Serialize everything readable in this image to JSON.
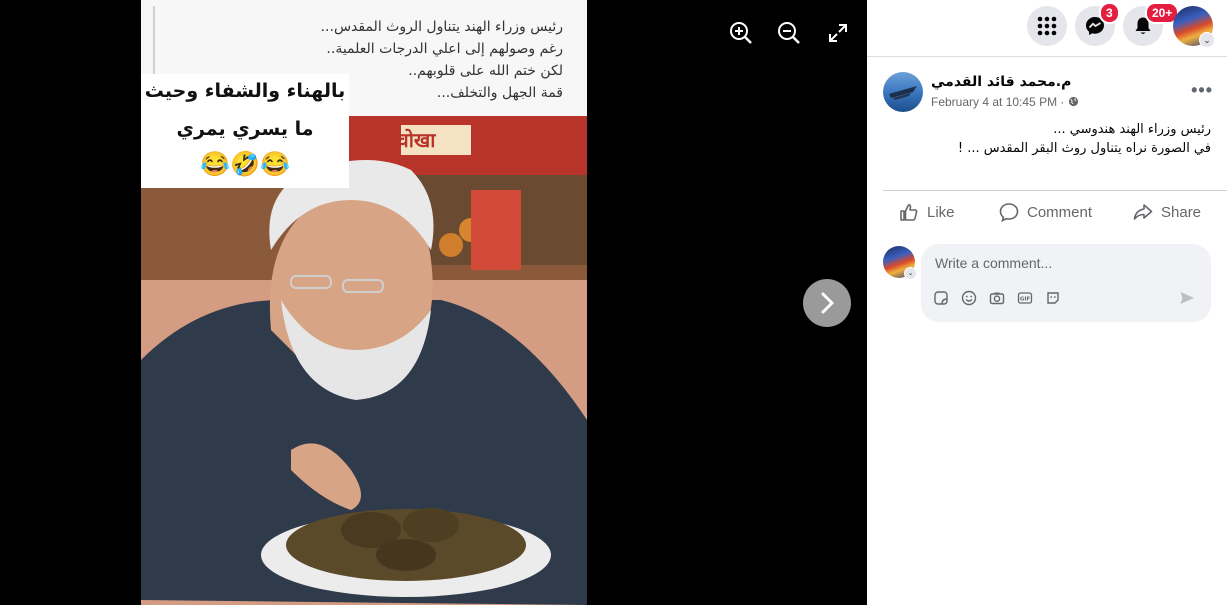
{
  "viewer": {
    "controls": [
      "zoom-in-icon",
      "zoom-out-icon",
      "fullscreen-icon",
      "next-arrow-icon"
    ],
    "background": "#000000"
  },
  "image": {
    "top_caption_lines": [
      "رئيس وزراء الهند يتناول الروث المقدس...",
      "رغم وصولهم إلى اعلي الدرجات العلمية..",
      "لكن ختم الله على قلوبهم..",
      "قمة الجهل والتخلف..."
    ],
    "overlay_line1": "بالهناء والشفاء وحيث",
    "overlay_line2": "ما يسري يمري",
    "overlay_emoji": "😂🤣😂",
    "sign_text": "चोखा"
  },
  "topbar": {
    "icons": [
      "menu-grid-icon",
      "messenger-icon",
      "bell-icon"
    ],
    "messenger_badge": "3",
    "notifications_badge": "20+"
  },
  "post": {
    "author": "م.محمد قائد القدمي",
    "timestamp": "February 4 at 10:45 PM",
    "audience_icon": "globe-icon",
    "more": "•••",
    "text_line1": "رئيس وزراء الهند هندوسي ...",
    "text_line2": "في الصورة نراه يتناول روث البقر المقدس ... !",
    "actions": {
      "like": "Like",
      "comment": "Comment",
      "share": "Share"
    },
    "comment_placeholder": "Write a comment...",
    "comment_tools": [
      "sticker-icon",
      "emoji-icon",
      "camera-icon",
      "gif-icon",
      "avatar-sticker-icon"
    ]
  },
  "colors": {
    "badge": "#e41e3f",
    "text_secondary": "#65676b",
    "surface": "#f0f2f5"
  }
}
